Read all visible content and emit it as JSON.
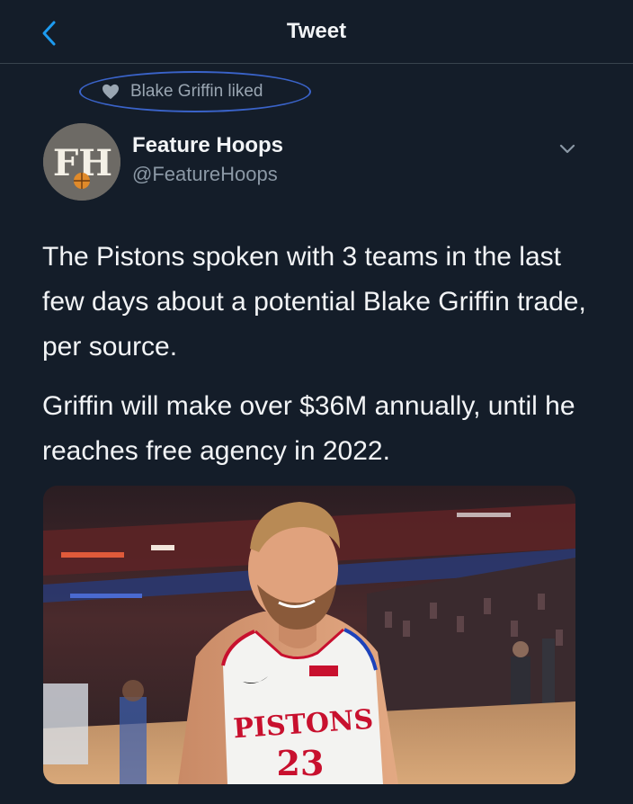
{
  "header": {
    "title": "Tweet"
  },
  "social_context": {
    "text": "Blake Griffin liked"
  },
  "author": {
    "name": "Feature Hoops",
    "handle": "@FeatureHoops",
    "avatar_initials": "FH"
  },
  "tweet": {
    "paragraphs": [
      "The Pistons spoken with 3 teams in the last few days about a potential Blake Griffin trade, per source.",
      "Griffin will make over $36M annually, until he reaches free agency in 2022."
    ]
  },
  "media": {
    "jersey_text": "PISTONS",
    "jersey_number": "23"
  },
  "colors": {
    "background": "#141d29",
    "highlight_oval": "#3a63c9",
    "muted_text": "#8b98a5"
  }
}
